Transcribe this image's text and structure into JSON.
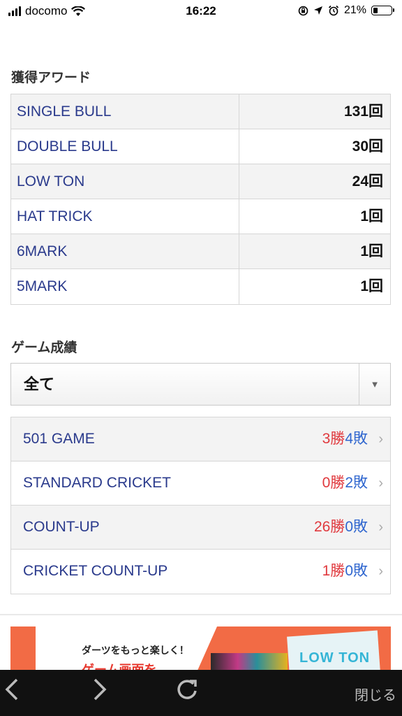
{
  "status_bar": {
    "carrier": "docomo",
    "time": "16:22",
    "battery": "21%"
  },
  "awards": {
    "title": "獲得アワード",
    "rows": [
      {
        "name": "SINGLE BULL",
        "count": "131回"
      },
      {
        "name": "DOUBLE BULL",
        "count": "30回"
      },
      {
        "name": "LOW TON",
        "count": "24回"
      },
      {
        "name": "HAT TRICK",
        "count": "1回"
      },
      {
        "name": "6MARK",
        "count": "1回"
      },
      {
        "name": "5MARK",
        "count": "1回"
      }
    ]
  },
  "games": {
    "title": "ゲーム成績",
    "filter": {
      "selected": "全て"
    },
    "rows": [
      {
        "name": "501 GAME",
        "wins": "3勝",
        "losses": "4敗"
      },
      {
        "name": "STANDARD CRICKET",
        "wins": "0勝",
        "losses": "2敗"
      },
      {
        "name": "COUNT-UP",
        "wins": "26勝",
        "losses": "0敗"
      },
      {
        "name": "CRICKET COUNT-UP",
        "wins": "1勝",
        "losses": "0敗"
      }
    ]
  },
  "banner": {
    "tagline": "ダーツをもっと楽しく！",
    "headline": "ゲーム画面を",
    "logo": "LOW TON"
  },
  "toolbar": {
    "close_label": "閉じる"
  },
  "colors": {
    "link_blue": "#2a3a8c",
    "win_red": "#e0393e",
    "loss_blue": "#2f66cf",
    "banner_orange": "#f26b45"
  }
}
